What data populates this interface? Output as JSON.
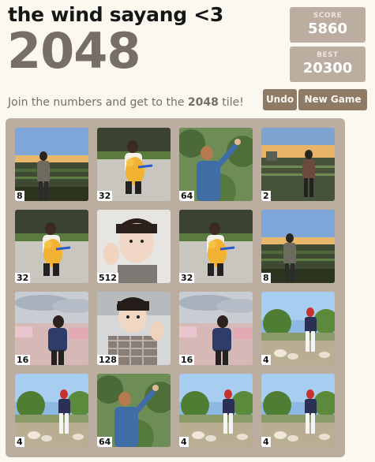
{
  "header": {
    "subtitle": "the wind sayang <3",
    "title": "2048"
  },
  "scores": {
    "score_label": "SCORE",
    "score_value": "5860",
    "best_label": "BEST",
    "best_value": "20300"
  },
  "intro": {
    "prefix": "Join the numbers and get to the ",
    "target": "2048",
    "suffix": " tile!"
  },
  "buttons": {
    "undo": "Undo",
    "new_game": "New Game"
  },
  "colors": {
    "background": "#faf8ef",
    "board": "#bbada0",
    "button": "#8f7a66",
    "title": "#776e65"
  },
  "grid": {
    "rows": [
      [
        {
          "value": "8",
          "scene": "sunset-railing-person"
        },
        {
          "value": "32",
          "scene": "person-with-plush-parking"
        },
        {
          "value": "64",
          "scene": "person-reaching-trees"
        },
        {
          "value": "2",
          "scene": "sunset-railing-person-standing"
        }
      ],
      [
        {
          "value": "32",
          "scene": "person-with-plush-parking"
        },
        {
          "value": "512",
          "scene": "selfie-closeup"
        },
        {
          "value": "32",
          "scene": "person-with-plush-parking"
        },
        {
          "value": "8",
          "scene": "sunset-railing-person"
        }
      ],
      [
        {
          "value": "16",
          "scene": "person-under-umbrellas-market"
        },
        {
          "value": "128",
          "scene": "selfie-plaid-shirt"
        },
        {
          "value": "16",
          "scene": "person-under-umbrellas-market"
        },
        {
          "value": "4",
          "scene": "garden-with-dogs"
        }
      ],
      [
        {
          "value": "4",
          "scene": "garden-with-dogs"
        },
        {
          "value": "64",
          "scene": "person-reaching-trees"
        },
        {
          "value": "4",
          "scene": "garden-with-dogs"
        },
        {
          "value": "4",
          "scene": "garden-with-dogs"
        }
      ]
    ]
  }
}
